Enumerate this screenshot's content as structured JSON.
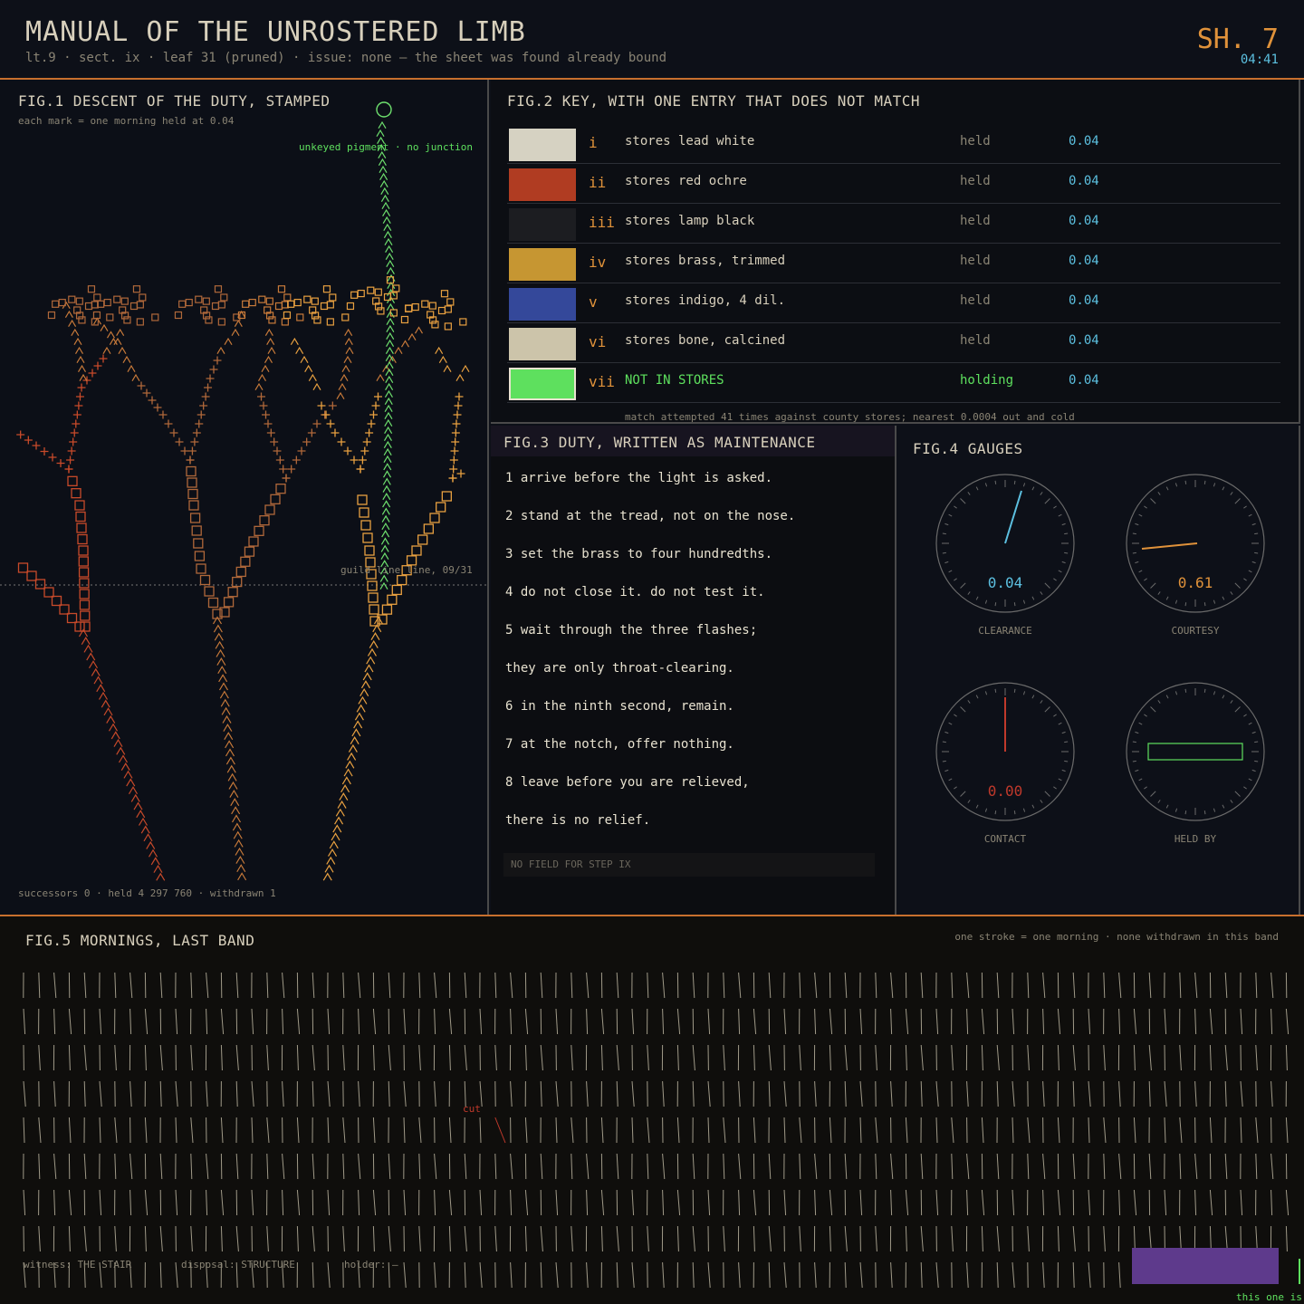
{
  "header": {
    "title": "MANUAL OF THE UNROSTERED LIMB",
    "subtitle": "lt.9  ·  sect. ix  ·  leaf 31 (pruned)  ·  issue: none — the sheet was found already bound",
    "sheet": "SH. 7",
    "clock": "04:41"
  },
  "fig1": {
    "title": "FIG.1  DESCENT OF THE DUTY, STAMPED",
    "note": "each mark = one morning held at 0.04",
    "unkeyed_label": "unkeyed pigment · no junction",
    "guild_line": "guild line line, 09/31",
    "footer": "successors 0   ·   held 4 297 760   ·   withdrawn 1"
  },
  "fig2": {
    "title": "FIG.2  KEY, WITH ONE ENTRY THAT DOES NOT MATCH",
    "entries": [
      {
        "num": "i",
        "name": "stores lead white",
        "state": "held",
        "value": "0.04",
        "color": "#d6d2c2"
      },
      {
        "num": "ii",
        "name": "stores red ochre",
        "state": "held",
        "value": "0.04",
        "color": "#b03c22"
      },
      {
        "num": "iii",
        "name": "stores lamp black",
        "state": "held",
        "value": "0.04",
        "color": "#1c1d21"
      },
      {
        "num": "iv",
        "name": "stores brass, trimmed",
        "state": "held",
        "value": "0.04",
        "color": "#c69632"
      },
      {
        "num": "v",
        "name": "stores indigo, 4 dil.",
        "state": "held",
        "value": "0.04",
        "color": "#34489a"
      },
      {
        "num": "vi",
        "name": "stores bone, calcined",
        "state": "held",
        "value": "0.04",
        "color": "#ccc4aa"
      },
      {
        "num": "vii",
        "name": "NOT IN STORES",
        "state": "holding",
        "value": "0.04",
        "color": "#5ee05e"
      }
    ],
    "footnote": "match attempted 41 times against county stores; nearest 0.0004 out and cold"
  },
  "fig3": {
    "title": "FIG.3  DUTY, WRITTEN AS MAINTENANCE",
    "steps": [
      "1  arrive before the light is asked.",
      "2  stand at the tread, not on the nose.",
      "3  set the brass to four hundredths.",
      "4  do not close it. do not test it.",
      "5  wait through the three flashes;",
      "     they are only throat-clearing.",
      "6  in the ninth second, remain.",
      "7  at the notch, offer nothing.",
      "8  leave before you are relieved,",
      "     there is no relief."
    ],
    "field_note": "NO FIELD FOR STEP IX"
  },
  "fig4": {
    "title": "FIG.4  GAUGES",
    "gauges": [
      {
        "label": "CLEARANCE",
        "value": "0.04",
        "fraction": 0.04,
        "color": "#5cc0e0"
      },
      {
        "label": "COURTESY",
        "value": "0.61",
        "fraction": 0.61,
        "color": "#e0923a"
      },
      {
        "label": "CONTACT",
        "value": "0.00",
        "fraction": 0.0,
        "color": "#c0392b"
      },
      {
        "label": "HELD BY",
        "value": "",
        "fraction": null,
        "color": "#5ee05e"
      }
    ]
  },
  "fig5": {
    "title": "FIG.5  MORNINGS, LAST BAND",
    "note": "one stroke = one morning · none withdrawn in this band",
    "cut_label": "cut",
    "witness": "witness: THE STAIR",
    "disposal": "disposal: STRUCTURE",
    "holder": "holder: —",
    "corner_note": "this one is",
    "colors": {
      "purple": "#5e3a8c",
      "green": "#5ee05e"
    }
  }
}
